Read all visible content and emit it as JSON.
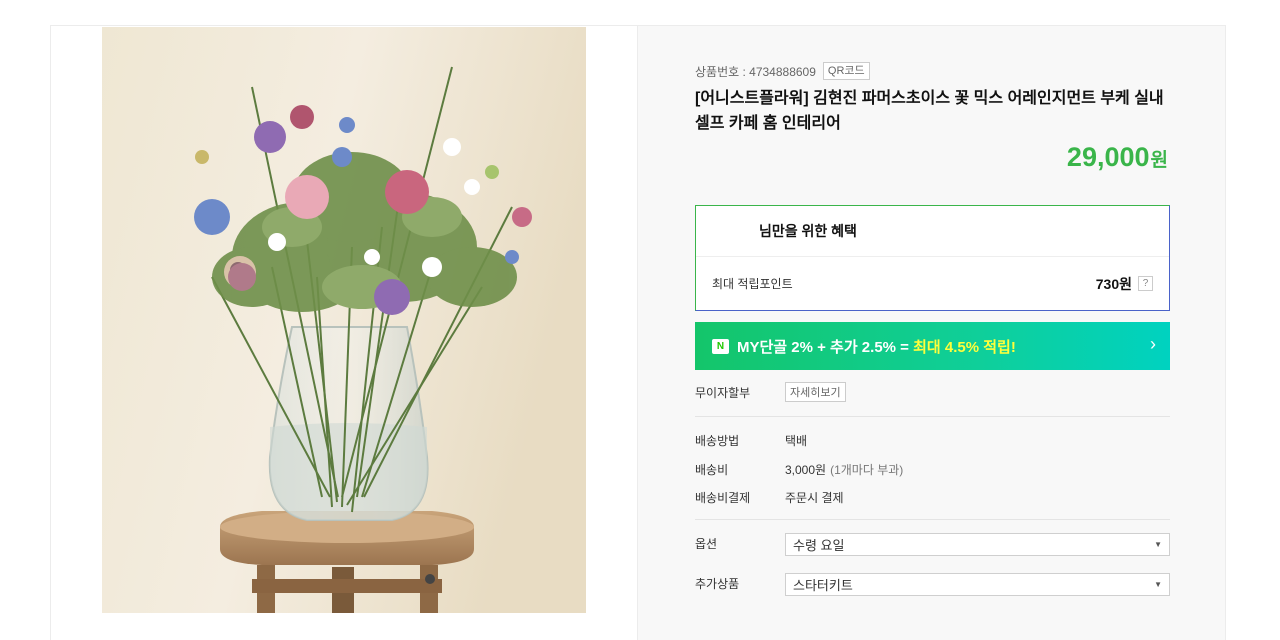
{
  "product": {
    "code_label": "상품번호 : 4734888609",
    "qr_label": "QR코드",
    "title": "[어니스트플라워] 김현진 파머스초이스 꽃 믹스 어레인지먼트 부케 실내 셀프 카페 홈 인테리어",
    "price_number": "29,000",
    "price_unit": "원"
  },
  "benefit": {
    "heading": "님만을 위한 혜택",
    "points_label": "최대 적립포인트",
    "points_value": "730원",
    "help": "?"
  },
  "banner": {
    "logo": "N",
    "text_a": "MY단골 2% + 추가 2.5% = ",
    "text_b": "최대 4.5% 적립!",
    "arrow": "›"
  },
  "installment": {
    "label": "무이자할부",
    "button": "자세히보기"
  },
  "shipping": {
    "method_label": "배송방법",
    "method_value": "택배",
    "fee_label": "배송비",
    "fee_value": "3,000원",
    "fee_note": "(1개마다 부과)",
    "pay_label": "배송비결제",
    "pay_value": "주문시 결제"
  },
  "options": {
    "option_label": "옵션",
    "option_value": "수령 요일",
    "addon_label": "추가상품",
    "addon_value": "스타터키트"
  },
  "colors": {
    "accent_green": "#3ab54a",
    "banner_yellow": "#ffff3b"
  }
}
